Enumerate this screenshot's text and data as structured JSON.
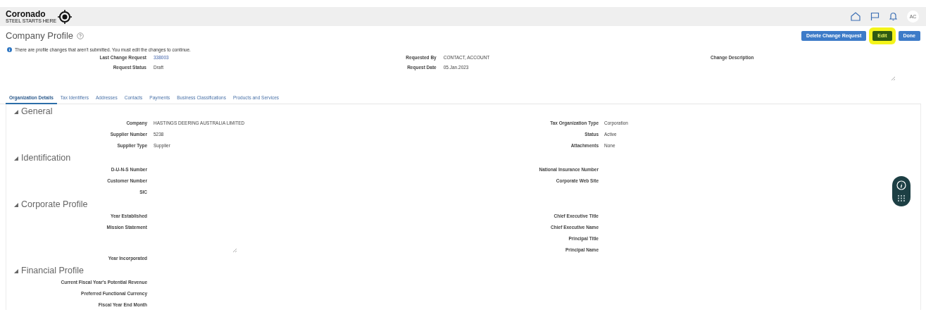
{
  "header": {
    "logo": {
      "name": "Coronado",
      "tagline": "STEEL STARTS HERE"
    },
    "avatar": "AC"
  },
  "page": {
    "title": "Company Profile"
  },
  "buttons": [
    {
      "label": "Delete Change Request",
      "kind": "primary"
    },
    {
      "label": "Edit",
      "kind": "highlighted"
    },
    {
      "label": "Done",
      "kind": "primary"
    }
  ],
  "notice": "There are profile changes that aren't submitted. You must edit the changes to continue.",
  "request": {
    "left": [
      {
        "label": "Last Change Request",
        "value": "338003",
        "kind": "link"
      },
      {
        "label": "Request Status",
        "value": "Draft",
        "kind": "text"
      }
    ],
    "middle": [
      {
        "label": "Requested By",
        "value": "CONTACT, ACCOUNT"
      },
      {
        "label": "Request Date",
        "value": "05.Jan.2023"
      }
    ],
    "description": {
      "label": "Change Description"
    }
  },
  "tabs": [
    {
      "label": "Organization Details",
      "selected": true
    },
    {
      "label": "Tax Identifiers",
      "selected": false
    },
    {
      "label": "Addresses",
      "selected": false
    },
    {
      "label": "Contacts",
      "selected": false
    },
    {
      "label": "Payments",
      "selected": false
    },
    {
      "label": "Business Classifications",
      "selected": false
    },
    {
      "label": "Products and Services",
      "selected": false
    }
  ],
  "sections": [
    {
      "title": "General",
      "expanded": true,
      "left": [
        {
          "label": "Company",
          "value": "HASTINGS DEERING AUSTRALIA LIMITED"
        },
        {
          "label": "Supplier Number",
          "value": "5238"
        },
        {
          "label": "Supplier Type",
          "value": "Supplier"
        }
      ],
      "right": [
        {
          "label": "Tax Organization Type",
          "value": "Corporation"
        },
        {
          "label": "Status",
          "value": "Active"
        },
        {
          "label": "Attachments",
          "value": "None"
        }
      ]
    },
    {
      "title": "Identification",
      "expanded": true,
      "left": [
        {
          "label": "D-U-N-S Number"
        },
        {
          "label": "Customer Number"
        },
        {
          "label": "SIC"
        }
      ],
      "right": [
        {
          "label": "National Insurance Number"
        },
        {
          "label": "Corporate Web Site"
        }
      ]
    },
    {
      "title": "Corporate Profile",
      "expanded": true,
      "left": [
        {
          "label": "Year Established"
        },
        {
          "label": "Mission Statement",
          "kind": "textarea"
        },
        {
          "label": "Year Incorporated"
        }
      ],
      "right": [
        {
          "label": "Chief Executive Title"
        },
        {
          "label": "Chief Executive Name"
        },
        {
          "label": "Principal Title"
        },
        {
          "label": "Principal Name"
        }
      ]
    },
    {
      "title": "Financial Profile",
      "expanded": true,
      "left": [
        {
          "label": "Current Fiscal Year's Potential Revenue"
        },
        {
          "label": "Preferred Functional Currency"
        },
        {
          "label": "Fiscal Year End Month"
        }
      ]
    }
  ]
}
